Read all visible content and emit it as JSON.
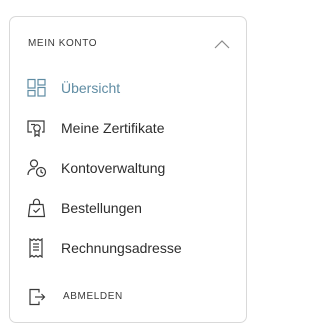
{
  "account_menu": {
    "title": "MEIN KONTO",
    "active_color": "#5f8ca3",
    "items": [
      {
        "label": "Übersicht",
        "icon": "dashboard-icon",
        "active": true
      },
      {
        "label": "Meine Zertifikate",
        "icon": "certificate-icon",
        "active": false
      },
      {
        "label": "Kontoverwaltung",
        "icon": "user-clock-icon",
        "active": false
      },
      {
        "label": "Bestellungen",
        "icon": "shopping-bag-icon",
        "active": false
      },
      {
        "label": "Rechnungsadresse",
        "icon": "receipt-icon",
        "active": false
      }
    ],
    "logout_label": "ABMELDEN"
  }
}
